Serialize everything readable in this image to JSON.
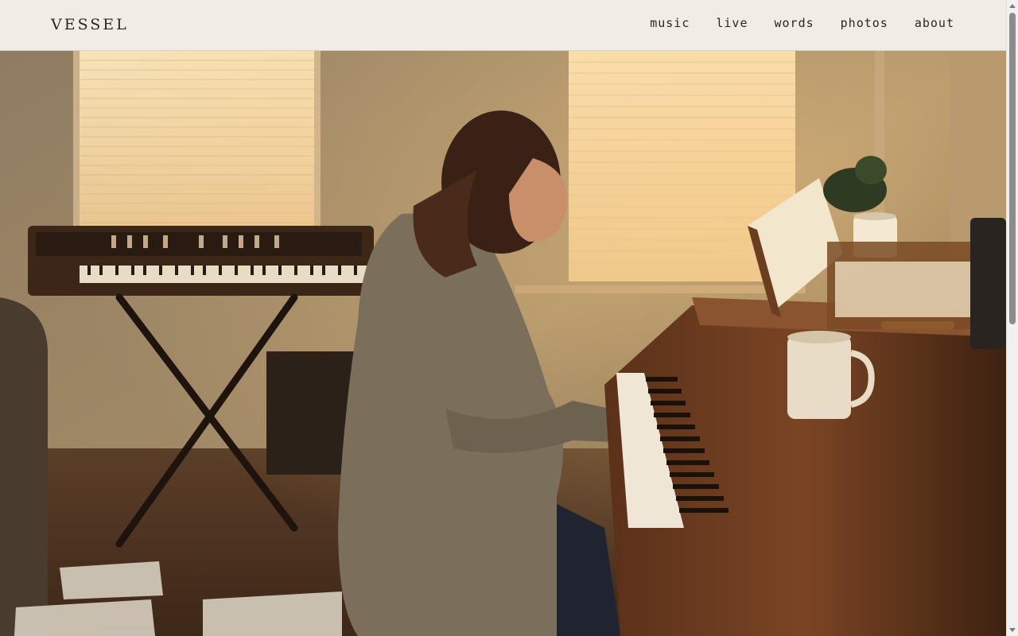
{
  "site": {
    "brand": "VESSEL"
  },
  "nav": {
    "items": [
      "music",
      "live",
      "words",
      "photos",
      "about"
    ]
  },
  "hero": {
    "image_alt_icon": "hero-photo-pianist"
  },
  "colors": {
    "header_bg": "#f1ece4",
    "text": "#2a2622"
  }
}
